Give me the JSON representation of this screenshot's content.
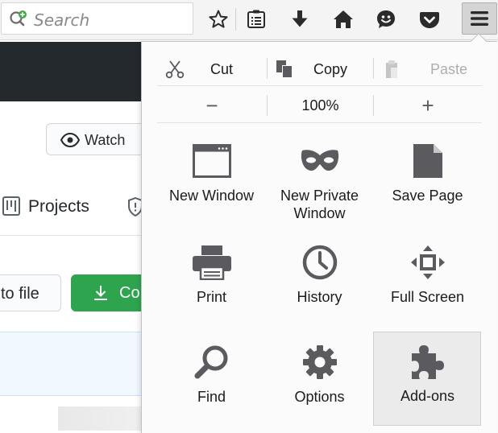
{
  "toolbar": {
    "search_placeholder": "Search",
    "icons": [
      "bookmark-star-icon",
      "reading-list-icon",
      "downloads-icon",
      "home-icon",
      "emoji-icon",
      "pocket-icon",
      "hamburger-menu-icon"
    ]
  },
  "page": {
    "watch_label": "Watch",
    "projects_label": "Projects",
    "goto_file_label": "to file",
    "code_label": "Co"
  },
  "menu": {
    "edit": {
      "cut_label": "Cut",
      "copy_label": "Copy",
      "paste_label": "Paste"
    },
    "zoom": {
      "minus_label": "−",
      "level": "100%",
      "plus_label": "+"
    },
    "items": [
      {
        "label": "New Window",
        "icon": "new-window-icon"
      },
      {
        "label": "New Private\nWindow",
        "icon": "private-mask-icon"
      },
      {
        "label": "Save Page",
        "icon": "save-page-icon"
      },
      {
        "label": "Print",
        "icon": "printer-icon"
      },
      {
        "label": "History",
        "icon": "history-clock-icon"
      },
      {
        "label": "Full Screen",
        "icon": "full-screen-icon"
      },
      {
        "label": "Find",
        "icon": "magnifier-icon"
      },
      {
        "label": "Options",
        "icon": "gear-icon"
      },
      {
        "label": "Add-ons",
        "icon": "puzzle-icon"
      }
    ]
  },
  "colors": {
    "icon_gray": "#5a5a5f",
    "toolbar_icon": "#2b2b2b",
    "code_button_green": "#2ea44f",
    "page_header_dark": "#24292e",
    "addons_hover": "#ebebeb"
  }
}
